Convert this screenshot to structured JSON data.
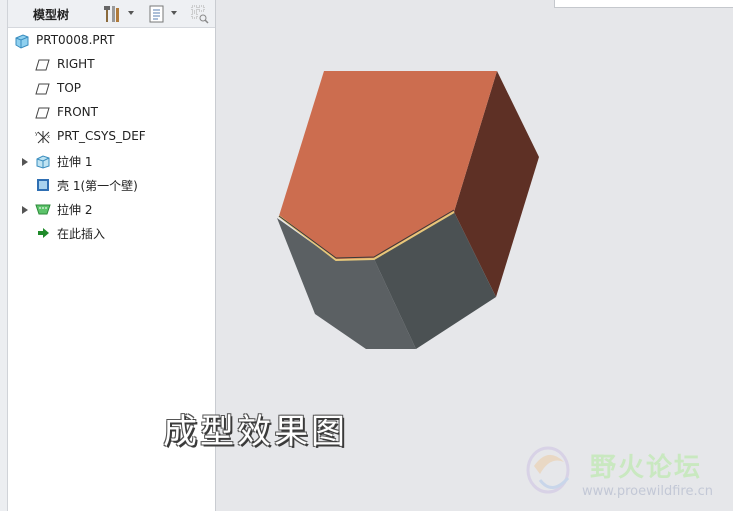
{
  "model_tree": {
    "title": "模型树",
    "items": [
      {
        "label": "PRT0008.PRT"
      },
      {
        "label": "RIGHT"
      },
      {
        "label": "TOP"
      },
      {
        "label": "FRONT"
      },
      {
        "label": "PRT_CSYS_DEF"
      },
      {
        "label": "拉伸 1"
      },
      {
        "label": "壳 1(第一个壁)"
      },
      {
        "label": "拉伸 2"
      },
      {
        "label": "在此插入"
      }
    ]
  },
  "viewport": {
    "caption": "成型效果图",
    "watermark_title": "野火论坛",
    "watermark_url": "www.proewildfire.cn"
  },
  "colors": {
    "top_face": "#cc6d4f",
    "side_face_dark": "#5e3025",
    "front_face": "#5b6063",
    "right_face": "#4b5153",
    "edge_highlight": "#e7c77a"
  }
}
